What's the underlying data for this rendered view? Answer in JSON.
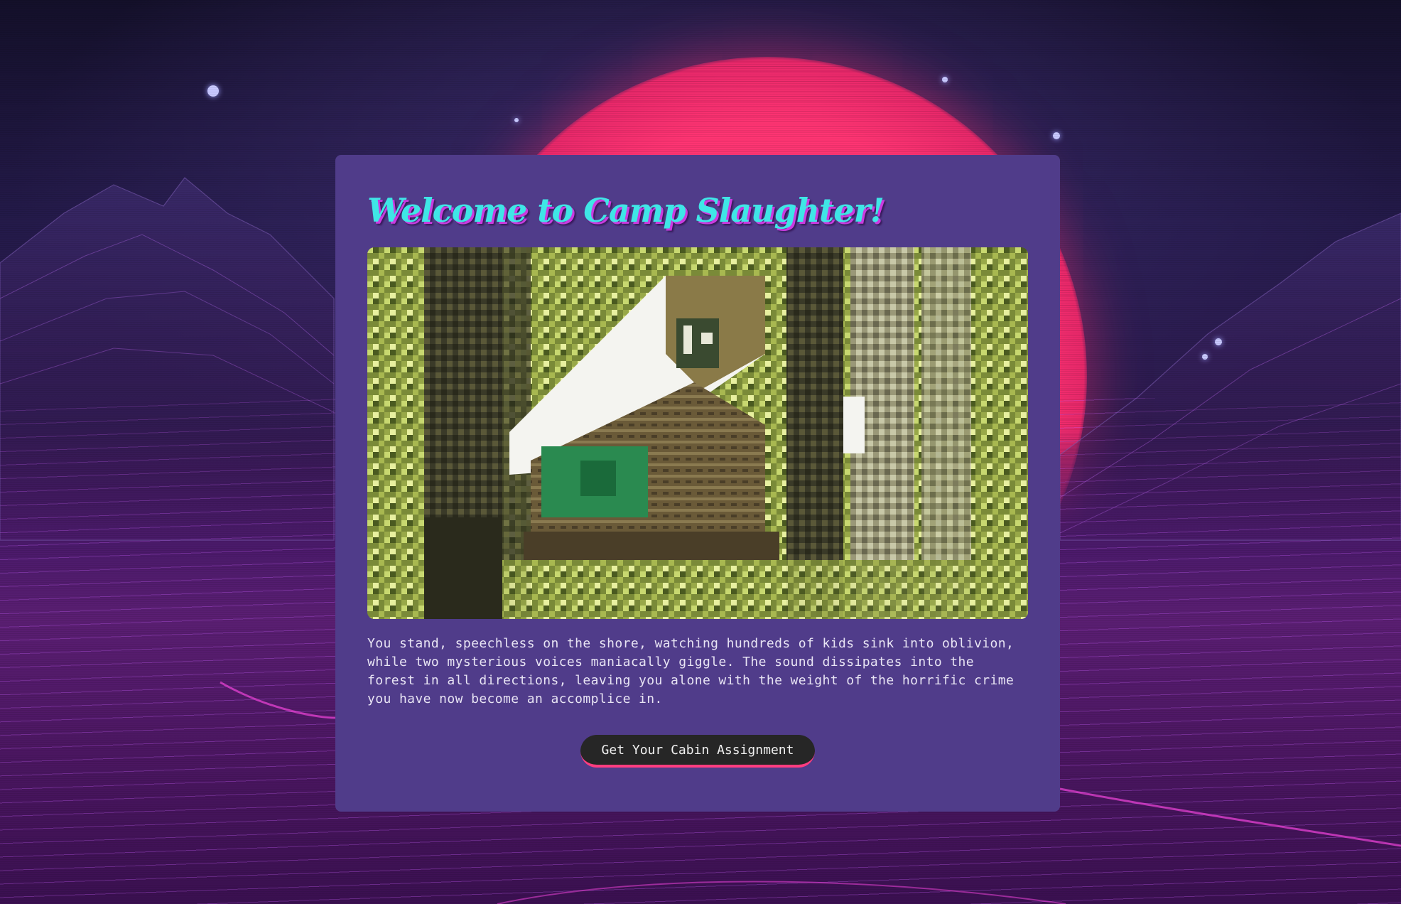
{
  "title": "Welcome to Camp Slaughter!",
  "image": {
    "subject": "pixel-art log cabin in a forest"
  },
  "story": "You stand, speechless on the shore, watching hundreds of kids sink into oblivion, while two mysterious voices maniacally giggle. The sound dissipates into the forest in all directions, leaving you alone with the weight of the horrific crime you have now become an accomplice in.",
  "action": {
    "label": "Get Your Cabin Assignment"
  },
  "colors": {
    "card_bg": "#503c8a",
    "title": "#3fe6e6",
    "title_shadow": "#c93bdf",
    "button_bg": "#262626",
    "button_accent": "#ff3d7f",
    "sun": "#ff3573"
  }
}
